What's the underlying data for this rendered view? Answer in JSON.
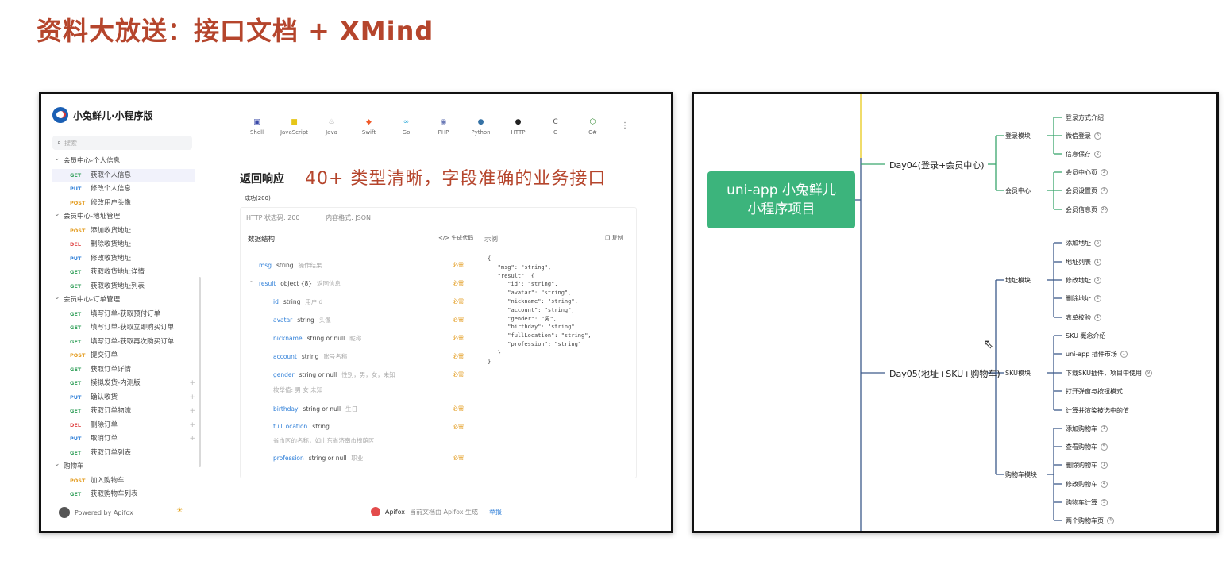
{
  "slide": {
    "title": "资料大放送：接口文档 + XMind"
  },
  "api_doc": {
    "brand": "小兔鲜儿·小程序版",
    "search_placeholder": "搜索",
    "nav": [
      {
        "type": "group",
        "label": "会员中心-个人信息"
      },
      {
        "type": "item",
        "method": "GET",
        "label": "获取个人信息",
        "active": true
      },
      {
        "type": "item",
        "method": "PUT",
        "label": "修改个人信息"
      },
      {
        "type": "item",
        "method": "POST",
        "label": "修改用户头像"
      },
      {
        "type": "group",
        "label": "会员中心-地址管理"
      },
      {
        "type": "item",
        "method": "POST",
        "label": "添加收货地址"
      },
      {
        "type": "item",
        "method": "DEL",
        "label": "删除收货地址"
      },
      {
        "type": "item",
        "method": "PUT",
        "label": "修改收货地址"
      },
      {
        "type": "item",
        "method": "GET",
        "label": "获取收货地址详情"
      },
      {
        "type": "item",
        "method": "GET",
        "label": "获取收货地址列表"
      },
      {
        "type": "group",
        "label": "会员中心-订单管理"
      },
      {
        "type": "item",
        "method": "GET",
        "label": "填写订单-获取预付订单"
      },
      {
        "type": "item",
        "method": "GET",
        "label": "填写订单-获取立即购买订单"
      },
      {
        "type": "item",
        "method": "GET",
        "label": "填写订单-获取再次购买订单"
      },
      {
        "type": "item",
        "method": "POST",
        "label": "提交订单"
      },
      {
        "type": "item",
        "method": "GET",
        "label": "获取订单详情"
      },
      {
        "type": "item",
        "method": "GET",
        "label": "模拟发货-内测版",
        "plus": "+"
      },
      {
        "type": "item",
        "method": "PUT",
        "label": "确认收货",
        "plus": "+"
      },
      {
        "type": "item",
        "method": "GET",
        "label": "获取订单物流",
        "plus": "+"
      },
      {
        "type": "item",
        "method": "DEL",
        "label": "删除订单",
        "plus": "+"
      },
      {
        "type": "item",
        "method": "PUT",
        "label": "取消订单",
        "plus": "+"
      },
      {
        "type": "item",
        "method": "GET",
        "label": "获取订单列表"
      },
      {
        "type": "group",
        "label": "购物车"
      },
      {
        "type": "item",
        "method": "POST",
        "label": "加入购物车"
      },
      {
        "type": "item",
        "method": "GET",
        "label": "获取购物车列表"
      }
    ],
    "powered_by": "Powered by Apifox",
    "languages": [
      {
        "label": "Shell",
        "icon": "shell-icon",
        "glyph": "▣",
        "color": "#3a4aa8"
      },
      {
        "label": "JavaScript",
        "icon": "javascript-icon",
        "glyph": "■",
        "color": "#e6c619"
      },
      {
        "label": "Java",
        "icon": "java-icon",
        "glyph": "♨",
        "color": "#999999"
      },
      {
        "label": "Swift",
        "icon": "swift-icon",
        "glyph": "◆",
        "color": "#f05a28"
      },
      {
        "label": "Go",
        "icon": "go-icon",
        "glyph": "∞",
        "color": "#2aa8d8"
      },
      {
        "label": "PHP",
        "icon": "php-icon",
        "glyph": "◉",
        "color": "#6c7bb7"
      },
      {
        "label": "Python",
        "icon": "python-icon",
        "glyph": "●",
        "color": "#3572a5"
      },
      {
        "label": "HTTP",
        "icon": "http-icon",
        "glyph": "●",
        "color": "#222222"
      },
      {
        "label": "C",
        "icon": "c-icon",
        "glyph": "C",
        "color": "#555555"
      },
      {
        "label": "C#",
        "icon": "csharp-icon",
        "glyph": "⬡",
        "color": "#3b8e3b"
      }
    ],
    "more_glyph": "⋮",
    "section_title": "返回响应",
    "headline": "40+ 类型清晰，字段准确的业务接口",
    "status_tab": "成功(200)",
    "http_status": "HTTP 状态码: 200",
    "content_type": "内容格式: JSON",
    "structure_label": "数据结构",
    "gen_code_label": "</> 生成代码",
    "example_label": "示例",
    "copy_label": "复制",
    "required_label": "必需",
    "fields": [
      {
        "name": "msg",
        "type": "string",
        "desc": "操作结果",
        "required": "必需"
      },
      {
        "name": "result",
        "type": "object {8}",
        "desc": "返回信息",
        "required": "必需",
        "expander": "⌄"
      },
      {
        "name": "id",
        "type": "string",
        "desc": "用户id",
        "required": "必需"
      },
      {
        "name": "avatar",
        "type": "string",
        "desc": "头像",
        "required": "必需"
      },
      {
        "name": "nickname",
        "type": "string or null",
        "desc": "昵称",
        "required": "必需"
      },
      {
        "name": "account",
        "type": "string",
        "desc": "账号名称",
        "required": "必需"
      },
      {
        "name": "gender",
        "type": "string or null",
        "desc": "性别，男，女，未知",
        "required": "必需",
        "enum": "枚举值:   男    女    未知"
      },
      {
        "name": "birthday",
        "type": "string or null",
        "desc": "生日",
        "required": "必需"
      },
      {
        "name": "fullLocation",
        "type": "string",
        "desc": "",
        "required": "必需",
        "extra": "省市区的名称，如山东省济南市槐荫区"
      },
      {
        "name": "profession",
        "type": "string or null",
        "desc": "职业",
        "required": "必需"
      }
    ],
    "example_code": "{\n   \"msg\": \"string\",\n   \"result\": {\n      \"id\": \"string\",\n      \"avatar\": \"string\",\n      \"nickname\": \"string\",\n      \"account\": \"string\",\n      \"gender\": \"男\",\n      \"birthday\": \"string\",\n      \"fullLocation\": \"string\",\n      \"profession\": \"string\"\n   }\n}",
    "footer_brand": "Apifox",
    "footer_text": "当前文档由 Apifox 生成",
    "footer_report": "举报"
  },
  "mind_map": {
    "root": [
      "uni-app 小兔鲜儿",
      "小程序项目"
    ],
    "days": [
      {
        "label": "Day04(登录+会员中心)",
        "modules": [
          {
            "label": "登录模块",
            "children": [
              {
                "label": "登录方式介绍",
                "count": ""
              },
              {
                "label": "微信登录",
                "count": "6"
              },
              {
                "label": "信息保存",
                "count": "2"
              }
            ]
          },
          {
            "label": "会员中心",
            "children": [
              {
                "label": "会员中心页",
                "count": "2"
              },
              {
                "label": "会员设置页",
                "count": "3"
              },
              {
                "label": "会员信息页",
                "count": "20"
              }
            ]
          }
        ]
      },
      {
        "label": "Day05(地址+SKU+购物车)",
        "modules": [
          {
            "label": "地址模块",
            "children": [
              {
                "label": "添加地址",
                "count": "6"
              },
              {
                "label": "地址列表",
                "count": "1"
              },
              {
                "label": "修改地址",
                "count": "3"
              },
              {
                "label": "删除地址",
                "count": "2"
              },
              {
                "label": "表单校验",
                "count": "1"
              }
            ]
          },
          {
            "label": "SKU模块",
            "children": [
              {
                "label": "SKU 概念介绍",
                "count": ""
              },
              {
                "label": "uni-app 插件市场",
                "count": "1"
              },
              {
                "label": "下载SKU插件，项目中使用",
                "count": "9"
              },
              {
                "label": "打开弹窗与按钮模式",
                "count": ""
              },
              {
                "label": "计算并渲染被选中的值",
                "count": ""
              }
            ]
          },
          {
            "label": "购物车模块",
            "children": [
              {
                "label": "添加购物车",
                "count": "1"
              },
              {
                "label": "查看购物车",
                "count": "5"
              },
              {
                "label": "删除购物车",
                "count": "1"
              },
              {
                "label": "修改购物车",
                "count": "4"
              },
              {
                "label": "购物车计算",
                "count": "5"
              },
              {
                "label": "两个购物车页",
                "count": "4"
              }
            ]
          }
        ]
      }
    ],
    "colors": {
      "root_bg": "#3cb47c",
      "day04_branch": "#3aa66d",
      "day05_branch": "#3d5a8a",
      "trunk_top": "#e8c81a"
    }
  }
}
